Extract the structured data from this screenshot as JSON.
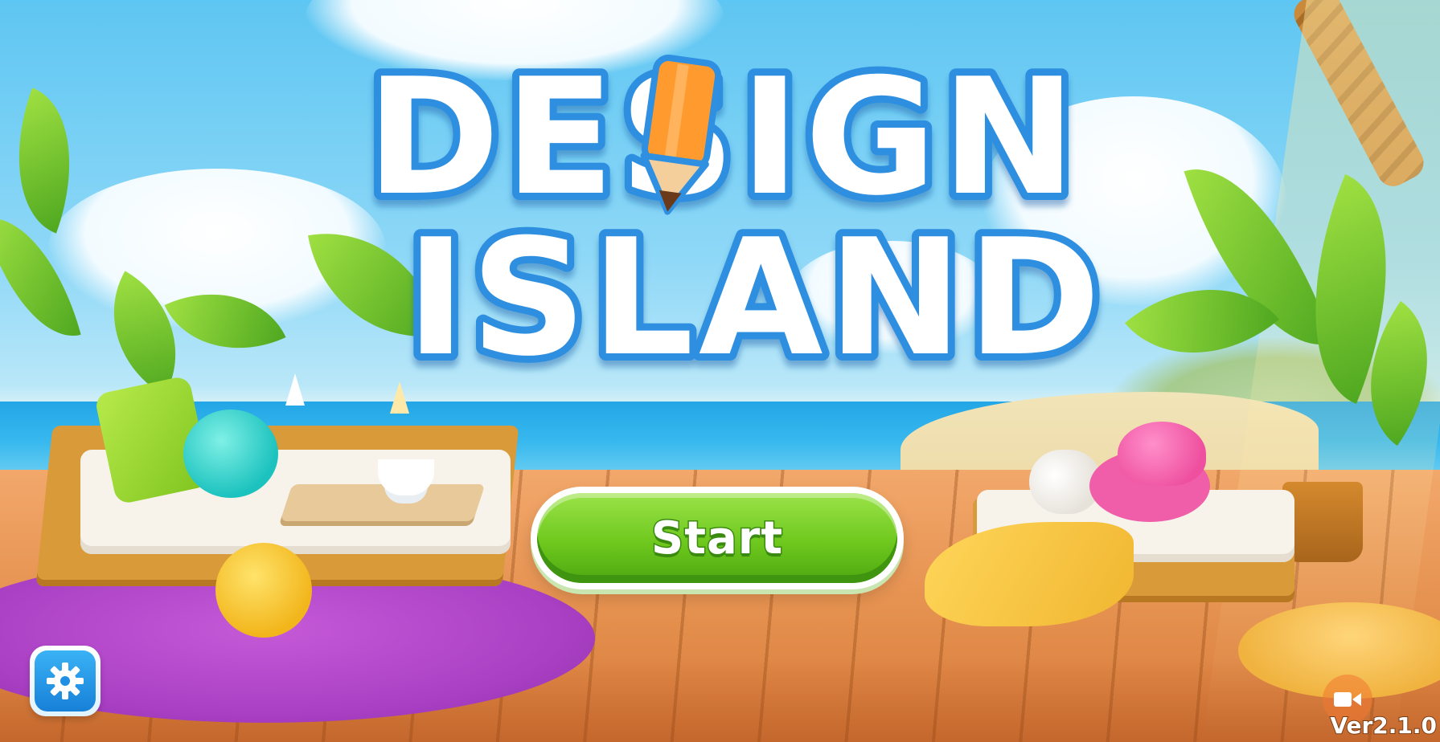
{
  "logo": {
    "line1": "DESIGN",
    "line2": "ISLAND",
    "fill_color": "#ffffff",
    "outline_color": "#2f8fe0",
    "pencil_color": "#ff9a2e"
  },
  "start_button": {
    "label": "Start",
    "color": "#6ec81d"
  },
  "settings_button": {
    "icon": "gear-icon",
    "color": "#1f8fe5"
  },
  "record_button": {
    "icon": "video-camera-icon"
  },
  "version": "Ver2.1.0"
}
